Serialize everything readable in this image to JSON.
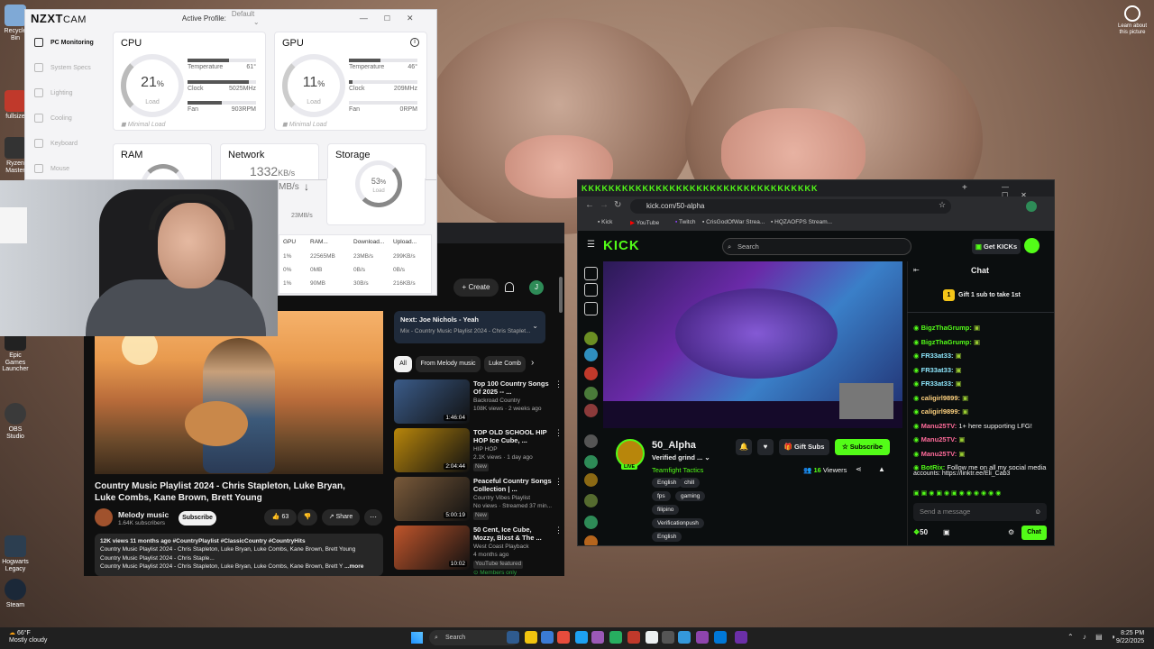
{
  "desktop": {
    "icons": [
      {
        "label": "Recycle Bin",
        "color": "#7fa9d6"
      },
      {
        "label": "fullsize",
        "color": "#c0392b"
      },
      {
        "label": "Ryzen Master",
        "color": "#333"
      },
      {
        "label": "Epic Games Launcher",
        "color": "#222"
      },
      {
        "label": "OBS Studio",
        "color": "#3a3a3a"
      },
      {
        "label": "Hogwarts Legacy",
        "color": "#2c3e50"
      },
      {
        "label": "Steam",
        "color": "#1b2838"
      }
    ],
    "learn": "Learn about this picture"
  },
  "nzxt": {
    "logo": "NZXT",
    "logo_sub": "CAM",
    "profile_label": "Active Profile:",
    "profile_value": "Default",
    "nav": [
      "PC Monitoring",
      "System Specs",
      "Lighting",
      "Cooling",
      "Keyboard",
      "Mouse"
    ],
    "cpu": {
      "title": "CPU",
      "load": "21",
      "unit": "%",
      "load_label": "Load",
      "temp_label": "Temperature",
      "temp": "61°",
      "clock_label": "Clock",
      "clock": "5025MHz",
      "fan_label": "Fan",
      "fan": "903RPM",
      "status": "Minimal Load",
      "fill_temp": 0.61,
      "fill_clock": 0.9,
      "fill_fan": 0.5
    },
    "gpu": {
      "title": "GPU",
      "load": "11",
      "unit": "%",
      "load_label": "Load",
      "temp_label": "Temperature",
      "temp": "46°",
      "clock_label": "Clock",
      "clock": "209MHz",
      "fan_label": "Fan",
      "fan": "0RPM",
      "status": "Minimal Load",
      "fill_temp": 0.46,
      "fill_clock": 0.05,
      "fill_fan": 0
    },
    "ram": {
      "title": "RAM"
    },
    "network": {
      "title": "Network",
      "down": "1332",
      "down_unit": "KB/s",
      "up_unit": "MB/s",
      "small": "23",
      "small_unit": "MB/s"
    },
    "storage": {
      "title": "Storage",
      "load": "53",
      "unit": "%",
      "load_label": "Load"
    },
    "table": {
      "headers": [
        "GPU",
        "RAM...",
        "Download...",
        "Upload..."
      ],
      "rows": [
        [
          "1%",
          "22565MB",
          "23MB/s",
          "299KB/s"
        ],
        [
          "0%",
          "0MB",
          "0B/s",
          "0B/s"
        ],
        [
          "1%",
          "90MB",
          "30B/s",
          "216KB/s"
        ]
      ]
    }
  },
  "youtube": {
    "create": "Create",
    "avatar": "J",
    "next_label": "Next:",
    "next_title": "Joe Nichols - Yeah",
    "next_sub": "Mix - Country Music Playlist 2024 - Chris Staplet...",
    "chips": [
      "All",
      "From Melody music",
      "Luke Comb"
    ],
    "title": "Country Music Playlist 2024 - Chris Stapleton, Luke Bryan, Luke Combs, Kane Brown, Brett Young",
    "channel": "Melody music",
    "subs": "1.64K subscribers",
    "subscribe": "Subscribe",
    "likes": "63",
    "share": "Share",
    "desc_meta": "12K views  11 months ago  #CountryPlaylist #ClassicCountry #CountryHits",
    "desc1": "Country Music Playlist 2024 - Chris Stapleton, Luke Bryan, Luke Combs, Kane Brown, Brett Young",
    "desc2": "Country Music Playlist 2024 - Chris Staple...",
    "desc3": "Country Music Playlist 2024 - Chris Stapleton, Luke Bryan, Luke Combs, Kane Brown, Brett Y",
    "more": "...more",
    "recs": [
      {
        "title": "Top 100 Country Songs Of 2025 -- ...",
        "channel": "Backroad Country",
        "meta": "108K views · 2 weeks ago",
        "badge": "",
        "dur": "1:46:04",
        "thumb": "#3b5c8a"
      },
      {
        "title": "TOP OLD SCHOOL HIP HOP Ice Cube, ...",
        "channel": "HIP HOP",
        "meta": "2.1K views · 1 day ago",
        "badge": "New",
        "dur": "2:04:44",
        "thumb": "#b8860b"
      },
      {
        "title": "Peaceful Country Songs Collection | ...",
        "channel": "Country Vibes Playlist",
        "meta": "No views · Streamed 37 min...",
        "badge": "New",
        "dur": "5:00:19",
        "thumb": "#7a5a3a"
      },
      {
        "title": "50 Cent, Ice Cube, Mozzy, Blxst & The ...",
        "channel": "West Coast Playback",
        "meta": "4 months ago",
        "badge": "YouTube featured",
        "dur": "10:02",
        "thumb": "#c0552b"
      }
    ],
    "members": "Members only"
  },
  "kick": {
    "url": "kick.com/50-alpha",
    "bookmarks": [
      "Kick",
      "YouTube",
      "Twitch",
      "CrisGodOfWar Strea...",
      "HQZAOFPS Stream..."
    ],
    "logo": "KICK",
    "search": "Search",
    "get_kicks": "Get KICKs",
    "streamer": "50_Alpha",
    "live": "LIVE",
    "stream_title": "Verified grind ...",
    "category": "Teamfight Tactics",
    "tags": [
      "English",
      "chill",
      "fps",
      "gaming",
      "filipino",
      "Verificationpush",
      "English"
    ],
    "gift": "Gift Subs",
    "subscribe": "Subscribe",
    "viewers": "16",
    "viewers_label": "Viewers",
    "chat_title": "Chat",
    "gift_banner": "Gift 1 sub to take 1st",
    "gift_rank": "1",
    "chat": [
      {
        "user": "BigzThaGrump:",
        "text": "",
        "color": "#53fc18"
      },
      {
        "user": "BigzThaGrump:",
        "text": "",
        "color": "#53fc18"
      },
      {
        "user": "FR33at33:",
        "text": "",
        "color": "#8fe9ff"
      },
      {
        "user": "FR33at33:",
        "text": "",
        "color": "#8fe9ff"
      },
      {
        "user": "FR33at33:",
        "text": "",
        "color": "#8fe9ff"
      },
      {
        "user": "caligirl9899:",
        "text": "",
        "color": "#ffd27f"
      },
      {
        "user": "caligirl9899:",
        "text": "",
        "color": "#ffd27f"
      },
      {
        "user": "Manu25TV:",
        "text": " 1+ here supporting LFG!",
        "color": "#ff6b9a"
      },
      {
        "user": "Manu25TV:",
        "text": "",
        "color": "#ff6b9a"
      },
      {
        "user": "Manu25TV:",
        "text": "",
        "color": "#ff6b9a"
      },
      {
        "user": "BotRix:",
        "text": " Follow me on all my social media",
        "color": "#53fc18"
      }
    ],
    "chat_cont": "accounts: https://linktr.ee/Eli_Cab3",
    "send_placeholder": "Send a message",
    "points": "50",
    "chat_btn": "Chat"
  },
  "taskbar": {
    "temp": "66°F",
    "weather": "Mostly cloudy",
    "search": "Search",
    "time": "8:25 PM",
    "date": "9/22/2025"
  }
}
